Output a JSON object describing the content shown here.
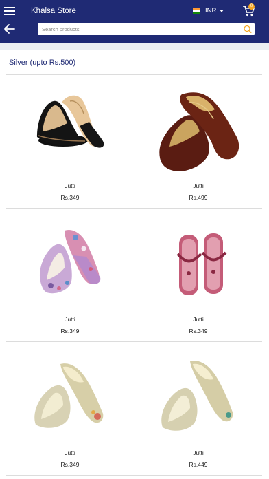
{
  "header": {
    "store_title": "Khalsa Store",
    "currency": "INR",
    "cart_count": "0",
    "search_placeholder": "Search products",
    "background_color": "#1f2a74",
    "badge_color": "#f5a623",
    "icons": {
      "menu": "hamburger-icon",
      "back": "arrow-left-icon",
      "search": "search-icon",
      "cart": "cart-icon",
      "flag": "india-flag-icon"
    }
  },
  "category": {
    "title": "Silver (upto Rs.500)"
  },
  "products": [
    {
      "name": "Jutti",
      "price": "Rs.349"
    },
    {
      "name": "Jutti",
      "price": "Rs.499"
    },
    {
      "name": "Jutti",
      "price": "Rs.349"
    },
    {
      "name": "Jutti",
      "price": "Rs.349"
    },
    {
      "name": "Jutti",
      "price": "Rs.349"
    },
    {
      "name": "Jutti",
      "price": "Rs.449"
    }
  ]
}
